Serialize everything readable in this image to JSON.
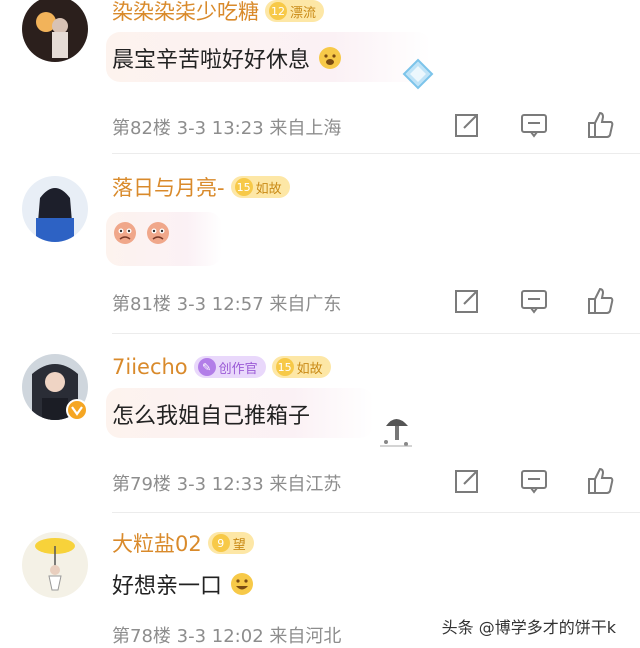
{
  "comments": [
    {
      "user": "染染染柒少吃糖",
      "level": "12",
      "badge": "漂流",
      "text": "晨宝辛苦啦好好休息",
      "floor": "第82楼",
      "date": "3-3",
      "time": "13:23",
      "location": "来自上海"
    },
    {
      "user": "落日与月亮-",
      "level": "15",
      "badge": "如故",
      "text": "",
      "floor": "第81楼",
      "date": "3-3",
      "time": "12:57",
      "location": "来自广东"
    },
    {
      "user": "7iiecho",
      "creator_badge": "创作官",
      "level": "15",
      "badge": "如故",
      "text": "怎么我姐自己推箱子",
      "floor": "第79楼",
      "date": "3-3",
      "time": "12:33",
      "location": "来自江苏"
    },
    {
      "user": "大粒盐02",
      "level": "9",
      "badge": "望",
      "text": "好想亲一口",
      "floor": "第78楼",
      "date": "3-3",
      "time": "12:02",
      "location": "来自河北"
    }
  ],
  "watermark": "头条 @博学多才的饼干k",
  "icons": [
    "edit-icon",
    "comment-icon",
    "like-icon"
  ],
  "colors": {
    "username": "#d98a2b",
    "meta": "#8d8d8d",
    "badge_bg": "#fde7a6",
    "creator_bg": "#e9d8fb"
  }
}
